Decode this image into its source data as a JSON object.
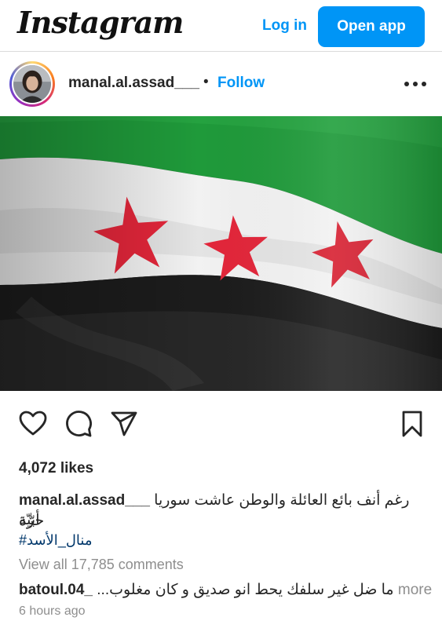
{
  "header": {
    "logo_text": "Instagram",
    "login_label": "Log in",
    "open_app_label": "Open app"
  },
  "post": {
    "username": "manal.al.assad___",
    "separator": "•",
    "follow_label": "Follow",
    "image_description_icon": "syrian-revolution-flag",
    "likes": "4,072 likes",
    "caption_user": "manal.al.assad___",
    "caption_line1": "رغم أنف بائع العائلة والوطن عاشت سوريا حرّة",
    "caption_line2": "أبيّة",
    "hashtag": "#منال_الأسد",
    "view_comments": "View all 17,785 comments",
    "comment_user": "batoul.04_",
    "comment_text": "ما ضل غير سلفك يحط انو صديق و كان مغلوب...",
    "comment_more": "more",
    "timestamp": "6 hours ago"
  },
  "icons": {
    "like": "heart-icon",
    "comment": "comment-icon",
    "share": "paper-plane-icon",
    "save": "bookmark-icon",
    "more": "more-horizontal-icon"
  },
  "colors": {
    "accent": "#0095f6",
    "flag_green": "#1f9a3a",
    "flag_white": "#f2f2f2",
    "flag_black": "#1c1c1c",
    "flag_star_red": "#e3263a"
  }
}
